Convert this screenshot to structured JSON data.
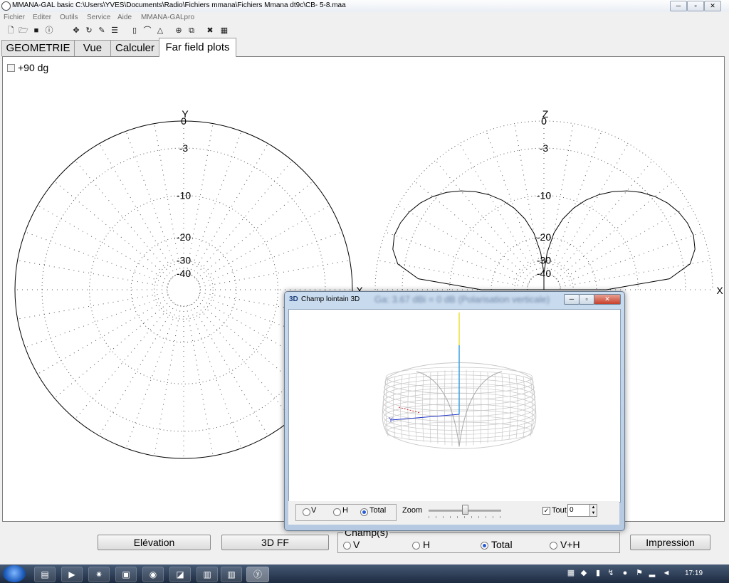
{
  "window": {
    "title": "MMANA-GAL basic C:\\Users\\YVES\\Documents\\Radio\\Fichiers mmana\\Fichiers Mmana dt9c\\CB- 5-8.maa",
    "min_label": "─",
    "max_label": "▫",
    "close_label": "✕"
  },
  "menu": [
    "Fichier",
    "Editer",
    "Outils",
    "Service",
    "Aide",
    "MMANA-GALpro"
  ],
  "toolbar_icons": [
    "new-file-icon",
    "open-folder-icon",
    "save-icon",
    "info-icon",
    "move-icon",
    "rotate-icon",
    "edit-icon",
    "wires-icon",
    "page-icon",
    "curve-icon",
    "triangle-icon",
    "target-icon",
    "copy-icon",
    "tools-icon",
    "calculator-icon"
  ],
  "tabs": [
    {
      "label": "GEOMETRIE",
      "active": false
    },
    {
      "label": "Vue",
      "active": false
    },
    {
      "label": "Calculer",
      "active": false
    },
    {
      "label": "Far field plots",
      "active": true
    }
  ],
  "plot_panel": {
    "checkbox_label": "+90 dg",
    "checked": false
  },
  "chart_data": [
    {
      "type": "polar",
      "title": "",
      "view": "horizontal",
      "axis_labels": {
        "up": "Y",
        "right": "X"
      },
      "radial_tick_labels": [
        "0",
        "-3",
        "-10",
        "-20",
        "-30",
        "-40"
      ],
      "radial_ticks_db": [
        0,
        -3,
        -10,
        -20,
        -30,
        -40
      ],
      "angular_grid_step_deg": 10,
      "pattern_db_at_all_azimuths": 0
    },
    {
      "type": "polar",
      "title": "",
      "view": "elevation",
      "axis_labels": {
        "up": "Z",
        "right": "X"
      },
      "radial_tick_labels": [
        "0",
        "-3",
        "-10",
        "-20",
        "-30",
        "-40"
      ],
      "radial_ticks_db": [
        0,
        -3,
        -10,
        -20,
        -30,
        -40
      ],
      "angular_grid_step_deg": 10,
      "elevation_deg": [
        0,
        5,
        10,
        15,
        20,
        25,
        30,
        35,
        40,
        45,
        50,
        55,
        60,
        65,
        70,
        75,
        80,
        85,
        90
      ],
      "gain_db": [
        -17,
        -5,
        -2.2,
        -1.3,
        -1.0,
        -1.1,
        -1.4,
        -1.9,
        -2.6,
        -3.5,
        -4.6,
        -5.9,
        -7.4,
        -9.2,
        -11.4,
        -14.3,
        -18.5,
        -26,
        -40
      ]
    }
  ],
  "window3d": {
    "icon_text": "3D",
    "title": "Champ lointain 3D",
    "blurred_header": "Ga: 3.67 dBi = 0 dB (Polarisation verticale)",
    "axis_y_label": "Y",
    "radios": [
      {
        "label": "V",
        "on": false
      },
      {
        "label": "H",
        "on": false
      },
      {
        "label": "Total",
        "on": true
      }
    ],
    "zoom_label": "Zoom",
    "zoom_value": 0.5,
    "tout_label": "Tout",
    "tout_checked": true,
    "tout_value": "0"
  },
  "bottom": {
    "elevation_button": "Elévation",
    "ff3d_button": "3D FF",
    "print_button": "Impression",
    "champ_title": "Champ(s)",
    "champ_options": [
      {
        "label": "V",
        "on": false
      },
      {
        "label": "H",
        "on": false
      },
      {
        "label": "Total",
        "on": true
      },
      {
        "label": "V+H",
        "on": false
      }
    ]
  },
  "taskbar": {
    "clock": "17:19",
    "apps": [
      "explorer-icon",
      "media-player-icon",
      "app-icon",
      "monitor-icon",
      "chrome-icon",
      "mmana-icon",
      "folder-icon",
      "folder2-icon",
      "mmana-active-icon"
    ],
    "tray": [
      "network-icon",
      "shield-icon",
      "chart-icon",
      "sync-icon",
      "antivirus-icon",
      "flag-icon",
      "signal-icon",
      "volume-icon"
    ]
  },
  "colors": {
    "vertical_axis": "#e8d800",
    "z_axis": "#3aa0e0",
    "y_axis": "#2438c8",
    "x_axis": "#d03030",
    "mesh": "#c8c8c8"
  }
}
